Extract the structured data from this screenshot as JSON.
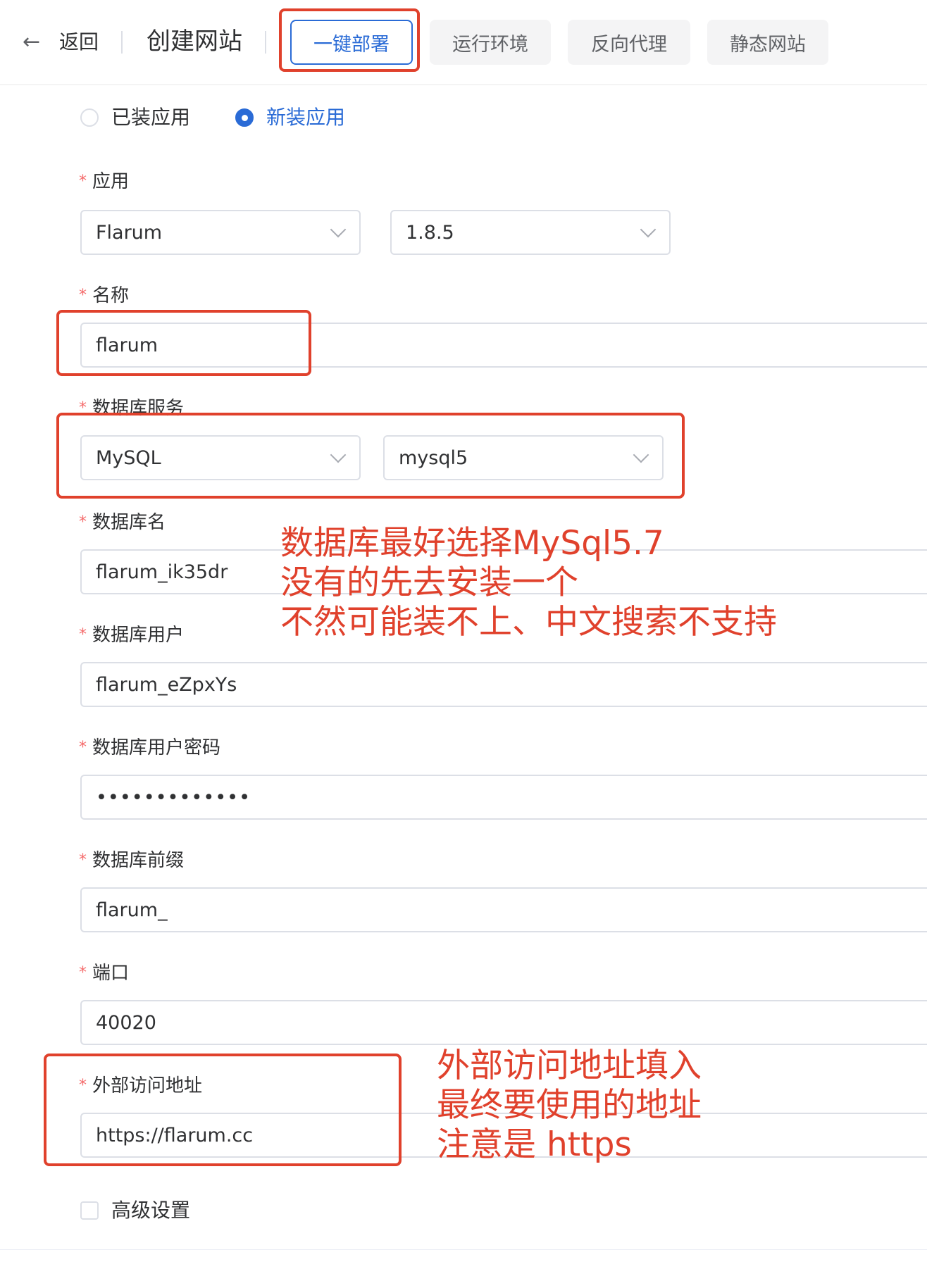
{
  "header": {
    "back_label": "返回",
    "title": "创建网站",
    "tabs": [
      {
        "label": "一键部署",
        "active": true
      },
      {
        "label": "运行环境",
        "active": false
      },
      {
        "label": "反向代理",
        "active": false
      },
      {
        "label": "静态网站",
        "active": false
      }
    ]
  },
  "mode": {
    "options": [
      {
        "label": "已装应用",
        "selected": false
      },
      {
        "label": "新装应用",
        "selected": true
      }
    ]
  },
  "form": {
    "required_mark": "*",
    "app": {
      "label": "应用",
      "name": "Flarum",
      "version": "1.8.5"
    },
    "name": {
      "label": "名称",
      "value": "flarum"
    },
    "db_service": {
      "label": "数据库服务",
      "type": "MySQL",
      "instance": "mysql5"
    },
    "db_name": {
      "label": "数据库名",
      "value": "flarum_ik35dr"
    },
    "db_user": {
      "label": "数据库用户",
      "value": "flarum_eZpxYs"
    },
    "db_password": {
      "label": "数据库用户密码",
      "value": "•••••••••••••"
    },
    "db_prefix": {
      "label": "数据库前缀",
      "value": "flarum_"
    },
    "port": {
      "label": "端口",
      "value": "40020"
    },
    "external_url": {
      "label": "外部访问地址",
      "value": "https://flarum.cc"
    },
    "advanced": {
      "label": "高级设置",
      "checked": false
    }
  },
  "annotations": {
    "db_note": [
      "数据库最好选择MySql5.7",
      "没有的先去安装一个",
      "不然可能装不上、中文搜索不支持"
    ],
    "url_note": [
      "外部访问地址填入",
      "最终要使用的地址",
      "注意是 https"
    ],
    "color": "#e0412c"
  },
  "theme": {
    "primary": "#2a6bd6",
    "required": "#f56c6c",
    "border": "#dcdfe6"
  }
}
